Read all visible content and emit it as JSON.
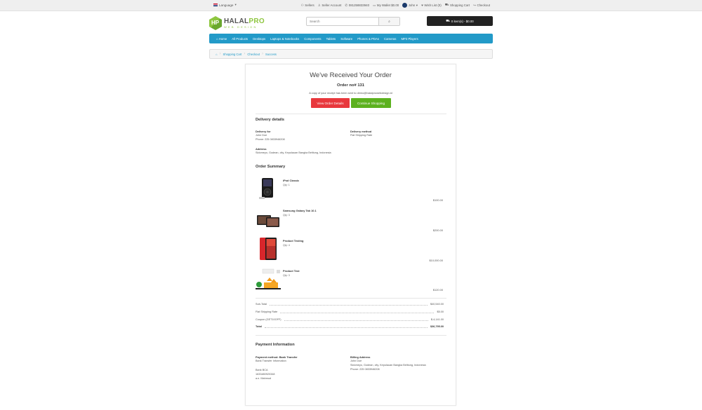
{
  "topbar": {
    "language": "Language",
    "links": {
      "sellers": "Sellers",
      "seller_account": "Seller Account",
      "phone": "081258833940",
      "wallet": "My Wallet $0.00",
      "user": "John",
      "wishlist": "Wish List (0)",
      "shopping_cart": "Shopping Cart",
      "checkout": "Checkout"
    }
  },
  "header": {
    "logo_main": "HALAL",
    "logo_accent": "PRO",
    "logo_sub": "WEB DESIGN",
    "search_placeholder": "Search",
    "cart": "0 item(s) - $0.00"
  },
  "nav": [
    "Home",
    "All Products",
    "Desktops",
    "Laptops & Notebooks",
    "Components",
    "Tablets",
    "Software",
    "Phones & PDAs",
    "Cameras",
    "MP3 Players"
  ],
  "breadcrumb": [
    "Shopping Cart",
    "Checkout",
    "Success"
  ],
  "order": {
    "title": "We've Received Your Order",
    "number": "Order no# 131",
    "receipt": "A copy of your receipt has been sent to  demo@halalprowebdesign.id",
    "view_button": "View Order Details",
    "continue_button": "Continue Shopping"
  },
  "delivery": {
    "heading": "Delivery details",
    "for_label": "Delivery for",
    "name": "John Doe",
    "phone": "Phone: 225 0833946208",
    "method_label": "Delivery method",
    "method": "Flat Shipping Rate",
    "address_label": "Address",
    "address": "Sidomeyo, Godean, city, Kepulauan Bangka Belitung, Indonesia"
  },
  "summary": {
    "heading": "Order Summary",
    "items": [
      {
        "name": "iPod Classic",
        "qty": "Qty: 1",
        "price": "$100.00"
      },
      {
        "name": "Samsung Galaxy Tab 10.1",
        "qty": "Qty: 3",
        "price": "$200.00"
      },
      {
        "name": "Product Testing",
        "qty": "Qty: 4",
        "price": "$10,000.00"
      },
      {
        "name": "Product Test",
        "qty": "Qty: 3",
        "price": "$120.00"
      }
    ]
  },
  "totals": [
    {
      "label": "Sub-Total",
      "value": "$40,540.00"
    },
    {
      "label": "Flat Shipping Rate",
      "value": "$5.00"
    },
    {
      "label": "Coupon (GET10OFF)",
      "value": "$-4,141.00"
    },
    {
      "label": "Total",
      "value": "$36,795.00"
    }
  ],
  "payment": {
    "heading": "Payment Information",
    "method_label": "Payment method: Bank Transfer",
    "method_info": "Bank Transfer Information",
    "bank": "Bank BCA",
    "account": "1633480920348",
    "holder": "a.n. Mahmud",
    "billing_label": "Billing Address",
    "billing_name": "John Doe",
    "billing_address": "Sidomeyo, Godean, city, Kepulauan Bangka Belitung, Indonesia",
    "billing_phone": "Phone: 225 0833946208"
  }
}
